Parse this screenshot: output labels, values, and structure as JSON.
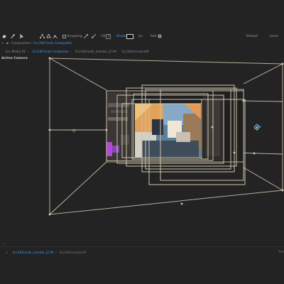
{
  "toolbar": {
    "snapping_label": "Snapping",
    "fill_label": "Fill",
    "stroke_label": "Stroke",
    "px_label": "px",
    "add_label": "Add",
    "default_label": "Default",
    "learn_label": "Learn",
    "h_key": "H",
    "s_key": "S",
    "g_key": "?"
  },
  "breadcrumb": {
    "panel_label": "Composition",
    "panel_value": "Ecc18(Fonds Composite",
    "item_1": "Ecc Media 01",
    "item_2": "Ecc18(Fonds Composite",
    "item_3": "Ecc18(Fonds_monitor_J2 AV",
    "item_4": "Ecc18(monitor)AV"
  },
  "viewer": {
    "label": "Active Camera"
  },
  "timeline": {
    "caret": "^",
    "item_1": "Ecc18(Fonds_monitor_J2 AV",
    "item_2": "Ecc18(monitor)AV",
    "right_label": "Ren"
  },
  "colors": {
    "background": "#232323",
    "accent": "#3d9dff",
    "frame_stroke": "#cfc4ae",
    "null_color": "#4fa9ff"
  }
}
